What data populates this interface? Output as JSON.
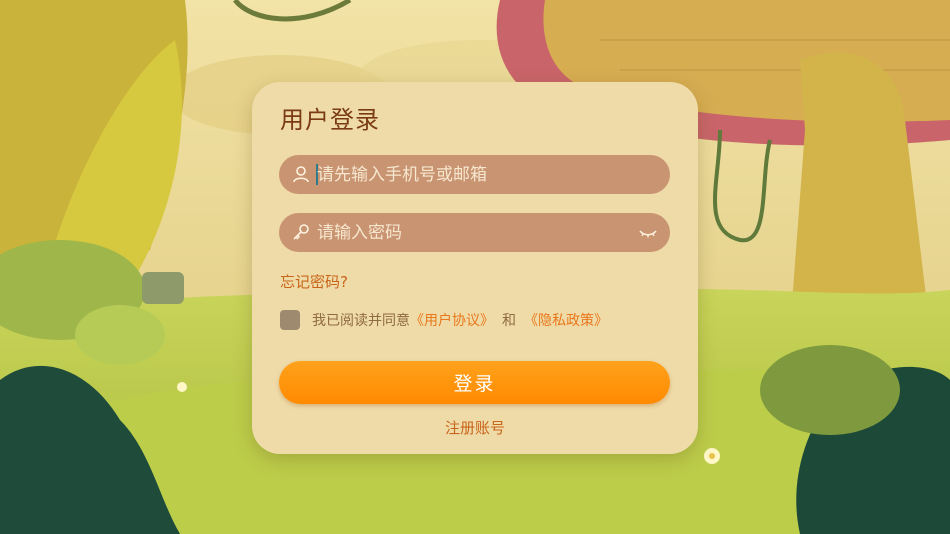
{
  "login": {
    "title": "用户登录",
    "phone_placeholder": "请先输入手机号或邮箱",
    "password_placeholder": "请输入密码",
    "forgot_password": "忘记密码?",
    "agreement": {
      "prefix": "我已阅读并同意",
      "user_agreement": "《用户协议》",
      "and": "和",
      "privacy_policy": "《隐私政策》",
      "checked": false
    },
    "login_button": "登录",
    "register_link": "注册账号"
  },
  "icons": {
    "phone_field": "user-icon",
    "password_field": "key-icon",
    "password_toggle": "eye-closed-icon"
  },
  "colors": {
    "card": "#efdba8",
    "input": "#c99472",
    "accent": "#ff8a00",
    "link": "#e9781c",
    "title": "#7a3b14"
  }
}
